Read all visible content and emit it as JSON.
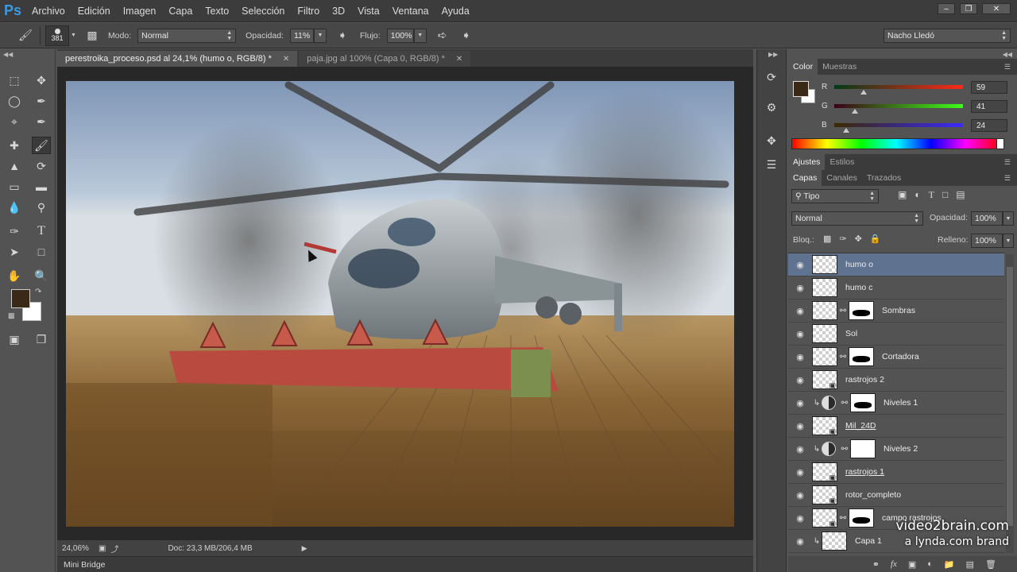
{
  "app": {
    "logo": "Ps"
  },
  "menubar": {
    "items": [
      "Archivo",
      "Edición",
      "Imagen",
      "Capa",
      "Texto",
      "Selección",
      "Filtro",
      "3D",
      "Vista",
      "Ventana",
      "Ayuda"
    ]
  },
  "options": {
    "brush_size": "381",
    "mode_label": "Modo:",
    "mode_value": "Normal",
    "opacity_label": "Opacidad:",
    "opacity_value": "11%",
    "flow_label": "Flujo:",
    "flow_value": "100%",
    "workspace": "Nacho Lledó"
  },
  "tabs": [
    {
      "label": "perestroika_proceso.psd al 24,1% (humo o, RGB/8) *",
      "active": true
    },
    {
      "label": "paja.jpg al 100% (Capa 0, RGB/8) *",
      "active": false
    }
  ],
  "status": {
    "zoom": "24,06%",
    "doc": "Doc: 23,3 MB/206,4 MB"
  },
  "mini_bridge": "Mini Bridge",
  "color_panel": {
    "tabs": [
      "Color",
      "Muestras"
    ],
    "foreground": "#3b2918",
    "background": "#ffffff",
    "channels": [
      {
        "label": "R",
        "value": "59",
        "fraction": 0.231
      },
      {
        "label": "G",
        "value": "41",
        "fraction": 0.161
      },
      {
        "label": "B",
        "value": "24",
        "fraction": 0.094
      }
    ]
  },
  "adjust_panel": {
    "tabs": [
      "Ajustes",
      "Estilos"
    ]
  },
  "layers_panel": {
    "tabs": [
      "Capas",
      "Canales",
      "Trazados"
    ],
    "filter_kind": "Tipo",
    "blend_mode": "Normal",
    "opacity_label": "Opacidad:",
    "opacity_value": "100%",
    "lock_label": "Bloq.:",
    "fill_label": "Relleno:",
    "fill_value": "100%",
    "layers": [
      {
        "name": "humo o",
        "selected": true,
        "mask": false,
        "adjustment": false,
        "clipped": false,
        "smart": false
      },
      {
        "name": "humo c",
        "selected": false,
        "mask": false,
        "adjustment": false,
        "clipped": false,
        "smart": false
      },
      {
        "name": "Sombras",
        "selected": false,
        "mask": true,
        "adjustment": false,
        "clipped": false,
        "smart": false
      },
      {
        "name": "Sol",
        "selected": false,
        "mask": false,
        "adjustment": false,
        "clipped": false,
        "smart": false
      },
      {
        "name": "Cortadora",
        "selected": false,
        "mask": true,
        "adjustment": false,
        "clipped": false,
        "smart": false
      },
      {
        "name": "rastrojos 2",
        "selected": false,
        "mask": false,
        "adjustment": false,
        "clipped": false,
        "smart": true
      },
      {
        "name": "Niveles 1",
        "selected": false,
        "mask": true,
        "adjustment": true,
        "clipped": true,
        "smart": false
      },
      {
        "name": "Mil_24D",
        "selected": false,
        "mask": false,
        "adjustment": false,
        "clipped": false,
        "smart": true
      },
      {
        "name": "Niveles 2",
        "selected": false,
        "mask": true,
        "adjustment": true,
        "clipped": true,
        "smart": false
      },
      {
        "name": "rastrojos 1",
        "selected": false,
        "mask": false,
        "adjustment": false,
        "clipped": false,
        "smart": true
      },
      {
        "name": "rotor_completo",
        "selected": false,
        "mask": false,
        "adjustment": false,
        "clipped": false,
        "smart": true
      },
      {
        "name": "campo rastrojos",
        "selected": false,
        "mask": true,
        "adjustment": false,
        "clipped": false,
        "smart": true
      },
      {
        "name": "Capa 1",
        "selected": false,
        "mask": false,
        "adjustment": false,
        "clipped": true,
        "smart": false
      }
    ]
  },
  "watermark": {
    "line1": "video2brain.com",
    "line2": "a lynda.com brand"
  }
}
